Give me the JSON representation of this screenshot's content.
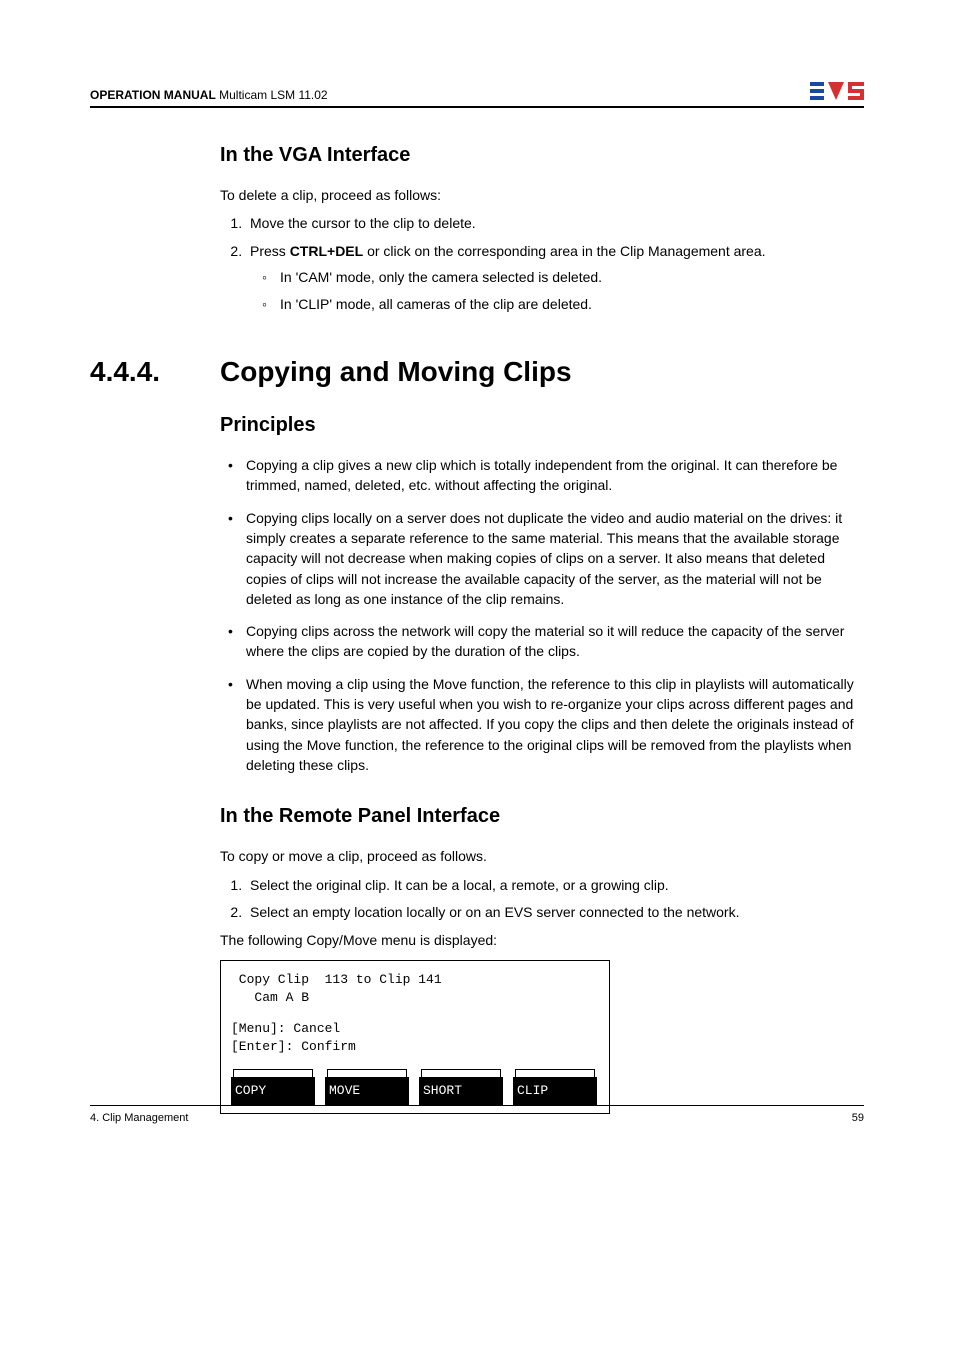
{
  "header": {
    "line_bold": "OPERATION MANUAL",
    "line_rest": " Multicam LSM 11.02"
  },
  "sections": {
    "vga": {
      "title": "In the VGA Interface",
      "intro": "To delete a clip, proceed as follows:",
      "steps": [
        {
          "text": "Move the cursor to the clip to delete."
        },
        {
          "pre": "Press ",
          "bold": "CTRL+DEL",
          "post": " or click on the corresponding area in the Clip Management area.",
          "subs": [
            "In 'CAM' mode, only the camera selected is deleted.",
            "In 'CLIP' mode, all cameras of the clip are deleted."
          ]
        }
      ]
    },
    "copying": {
      "num": "4.4.4.",
      "title": "Copying and Moving Clips",
      "principles_title": "Principles",
      "principles": [
        "Copying a clip gives a new clip which is totally independent from the original. It can therefore be trimmed, named, deleted, etc. without affecting the original.",
        "Copying clips locally on a server does not duplicate the video and audio material on the drives: it simply creates a separate reference to the same material. This means that the available storage capacity will not decrease when making copies of clips on a server. It also means that deleted copies of clips will not increase the available capacity of the server, as the material will not be deleted as long as one instance of the clip remains.",
        "Copying clips across the network will copy the material so it will reduce the capacity of the server where the clips are copied by the duration of the clips.",
        "When moving a clip using the Move function, the reference to this clip in playlists will automatically be updated. This is very useful when you wish to re-organize your clips across different pages and banks, since playlists are not affected. If you copy the clips and then delete the originals instead of using the Move function, the reference to the original clips will be removed from the playlists when deleting these clips."
      ],
      "remote_title": "In the Remote Panel Interface",
      "remote_intro": "To copy or move a clip, proceed as follows.",
      "remote_steps": [
        "Select the original clip. It can be a local, a remote, or a growing clip.",
        "Select an empty location locally or on an EVS server connected to the network."
      ],
      "remote_outro": "The following Copy/Move menu is displayed:"
    }
  },
  "panel": {
    "line1": " Copy Clip  113 to Clip 141",
    "line2": "   Cam A B",
    "line3": "[Menu]: Cancel",
    "line4": "[Enter]: Confirm",
    "buttons": [
      "COPY",
      "MOVE",
      "SHORT",
      "CLIP"
    ]
  },
  "footer": {
    "left": "4. Clip Management",
    "right": "59"
  }
}
